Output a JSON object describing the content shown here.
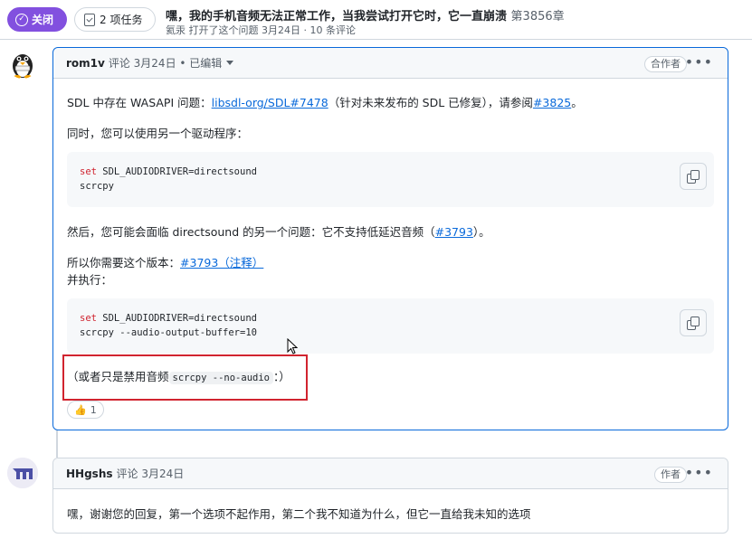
{
  "header": {
    "status_label": "关闭",
    "tasks_label": "2 项任务",
    "title": "嘿，我的手机音频无法正常工作，当我尝试打开它时，它一直崩溃",
    "issue_number": "第3856章",
    "subtitle": "氦汞 打开了这个问题 3月24日 · 10 条评论"
  },
  "comment1": {
    "author": "rom1v",
    "meta": "评论 3月24日 • 已编辑",
    "badge": "合作者",
    "p1_text": "SDL 中存在 WASAPI 问题：",
    "p1_link": "libsdl-org/SDL#7478",
    "p1_mid": "（针对未来发布的 SDL 已修复），请参阅",
    "p1_link2": "#3825",
    "p1_end": "。",
    "p2": "同时，您可以使用另一个驱动程序：",
    "code1_kw": "set",
    "code1_line1": " SDL_AUDIODRIVER=directsound",
    "code1_line2": "scrcpy",
    "p3_text": "然后，您可能会面临 directsound 的另一个问题：它不支持低延迟音频（",
    "p3_link": "#3793",
    "p3_end": "）。",
    "p4_text": "所以你需要这个版本：",
    "p4_link": "#3793（注释）",
    "p5": "并执行：",
    "code2_kw": "set",
    "code2_line1": " SDL_AUDIODRIVER=directsound",
    "code2_line2": "scrcpy --audio-output-buffer=10",
    "p6_pre": "（或者只是禁用音频",
    "p6_code": "scrcpy --no-audio",
    "p6_post": "：）",
    "reaction_emoji": "👍",
    "reaction_count": "1"
  },
  "comment2": {
    "author": "HHgshs",
    "meta": "评论 3月24日",
    "badge": "作者",
    "body": "嘿，谢谢您的回复，第一个选项不起作用，第二个我不知道为什么，但它一直给我未知的选项"
  },
  "colors": {
    "accent": "#8250df",
    "link": "#0969da",
    "highlight": "#d1242f"
  }
}
